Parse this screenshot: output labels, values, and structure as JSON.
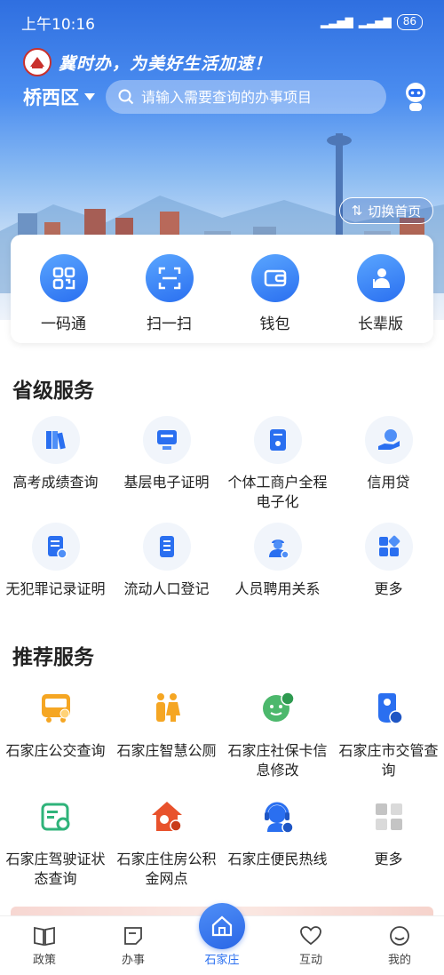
{
  "status": {
    "time": "上午10:16",
    "battery": "86"
  },
  "header": {
    "slogan": "冀时办，为美好生活加速！",
    "district": "桥西区",
    "search_placeholder": "请输入需要查询的办事项目",
    "switch_label": "切换首页"
  },
  "quick": [
    {
      "label": "一码通",
      "icon": "qrcode-icon"
    },
    {
      "label": "扫一扫",
      "icon": "scan-icon"
    },
    {
      "label": "钱包",
      "icon": "wallet-icon"
    },
    {
      "label": "长辈版",
      "icon": "elder-icon"
    }
  ],
  "provincial": {
    "title": "省级服务",
    "items": [
      {
        "label": "高考成绩查询",
        "icon": "books-icon"
      },
      {
        "label": "基层电子证明",
        "icon": "certificate-icon"
      },
      {
        "label": "个体工商户全程电子化",
        "icon": "business-doc-icon"
      },
      {
        "label": "信用贷",
        "icon": "loan-icon"
      },
      {
        "label": "无犯罪记录证明",
        "icon": "record-doc-icon"
      },
      {
        "label": "流动人口登记",
        "icon": "registration-icon"
      },
      {
        "label": "人员聘用关系",
        "icon": "worker-icon"
      },
      {
        "label": "更多",
        "icon": "more-grid-icon"
      }
    ]
  },
  "recommended": {
    "title": "推荐服务",
    "items": [
      {
        "label": "石家庄公交查询",
        "icon": "bus-icon"
      },
      {
        "label": "石家庄智慧公厕",
        "icon": "restroom-icon"
      },
      {
        "label": "石家庄社保卡信息修改",
        "icon": "social-card-icon"
      },
      {
        "label": "石家庄市交管查询",
        "icon": "traffic-icon"
      },
      {
        "label": "石家庄驾驶证状态查询",
        "icon": "license-icon"
      },
      {
        "label": "石家庄住房公积金网点",
        "icon": "housing-fund-icon"
      },
      {
        "label": "石家庄便民热线",
        "icon": "hotline-icon"
      },
      {
        "label": "更多",
        "icon": "more-grid-gray-icon"
      }
    ]
  },
  "nav": [
    {
      "label": "政策",
      "icon": "policy-icon"
    },
    {
      "label": "办事",
      "icon": "task-icon"
    },
    {
      "label": "石家庄",
      "icon": "home-icon"
    },
    {
      "label": "互动",
      "icon": "heart-icon"
    },
    {
      "label": "我的",
      "icon": "profile-icon"
    }
  ],
  "colors": {
    "primary": "#2a6ff0",
    "text": "#222222"
  }
}
